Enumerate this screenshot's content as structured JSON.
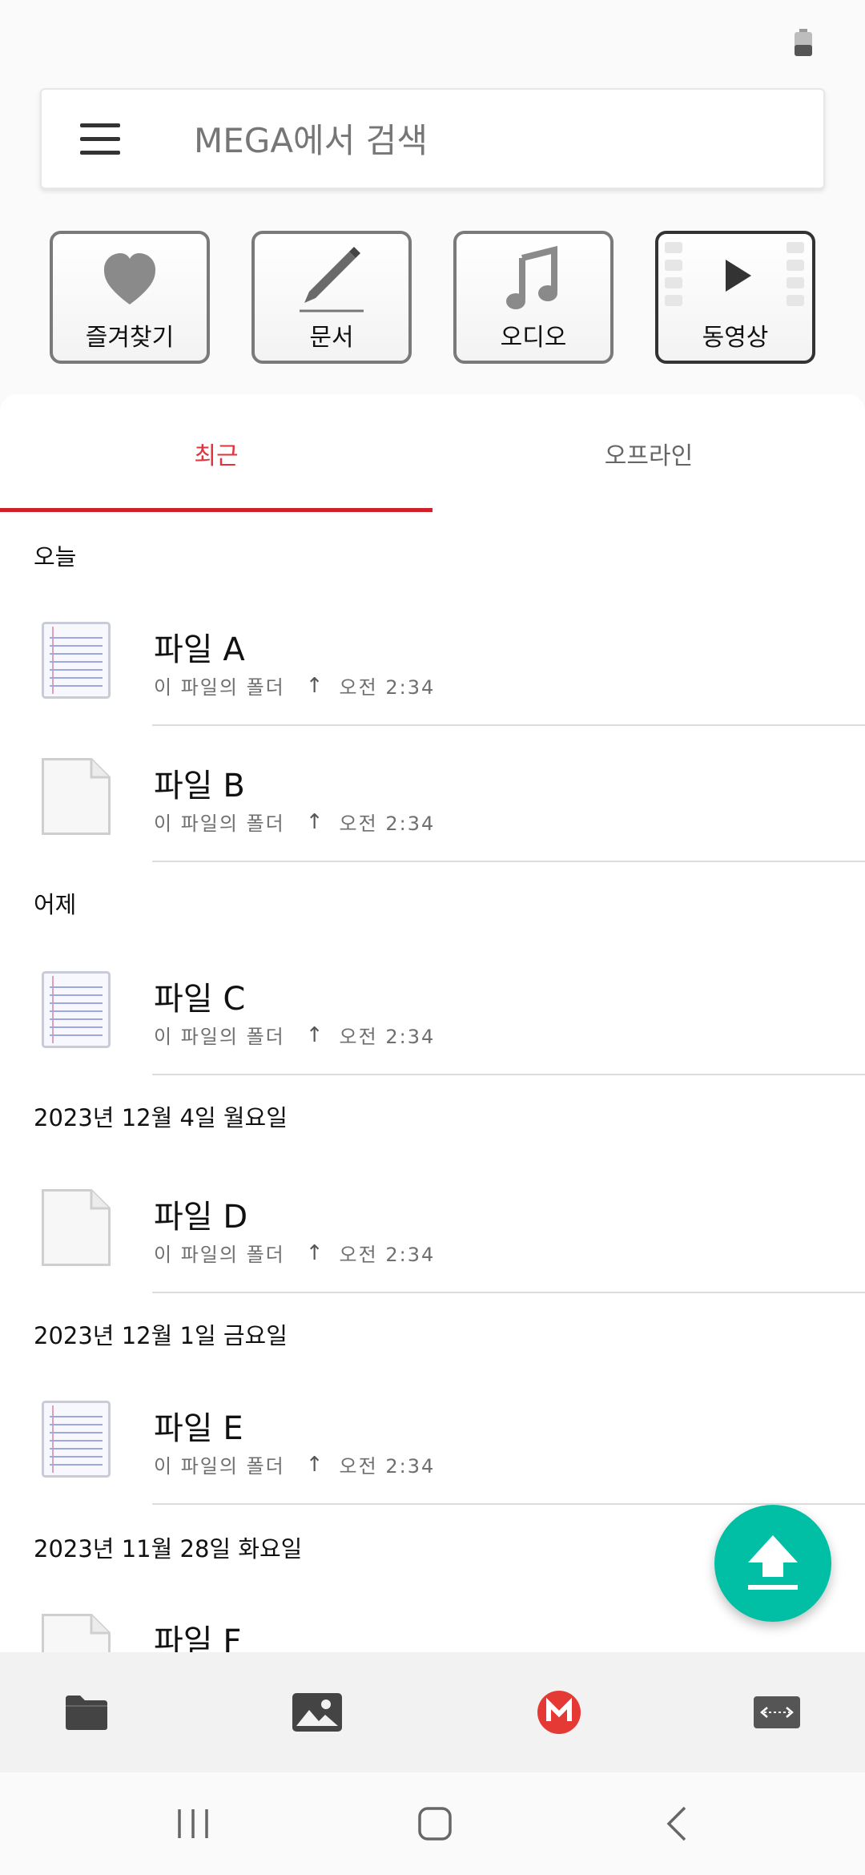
{
  "status_bar": {
    "battery_icon": "battery-low-icon"
  },
  "search": {
    "menu_icon": "hamburger-icon",
    "placeholder": "MEGA에서 검색"
  },
  "categories": [
    {
      "label": "즐겨찾기",
      "icon": "heart-icon"
    },
    {
      "label": "문서",
      "icon": "pencil-icon"
    },
    {
      "label": "오디오",
      "icon": "music-note-icon"
    },
    {
      "label": "동영상",
      "icon": "video-play-icon"
    }
  ],
  "tabs": [
    {
      "label": "최근",
      "active": true
    },
    {
      "label": "오프라인",
      "active": false
    }
  ],
  "groups": [
    {
      "date": "오늘",
      "files": [
        {
          "name": "파일 A",
          "type": "text",
          "folder": "이 파일의 폴더",
          "time": "오전 2:34"
        },
        {
          "name": "파일 B",
          "type": "blank",
          "folder": "이 파일의 폴더",
          "time": "오전 2:34"
        }
      ]
    },
    {
      "date": "어제",
      "files": [
        {
          "name": "파일 C",
          "type": "text",
          "folder": "이 파일의 폴더",
          "time": "오전 2:34"
        }
      ]
    },
    {
      "date": "2023년 12월 4일 월요일",
      "files": [
        {
          "name": "파일 D",
          "type": "blank",
          "folder": "이 파일의 폴더",
          "time": "오전 2:34"
        }
      ]
    },
    {
      "date": "2023년 12월 1일 금요일",
      "files": [
        {
          "name": "파일 E",
          "type": "text",
          "folder": "이 파일의 폴더",
          "time": "오전 2:34"
        }
      ]
    },
    {
      "date": "2023년 11월 28일 화요일",
      "files": [
        {
          "name": "파일 F",
          "type": "blank",
          "folder": "",
          "time": ""
        }
      ]
    }
  ],
  "upload_meta_arrow": "↑",
  "fab": {
    "icon": "upload-icon"
  },
  "bottom_nav": [
    {
      "icon": "folder-icon"
    },
    {
      "icon": "photos-icon"
    },
    {
      "icon": "mega-logo-icon"
    },
    {
      "icon": "transfers-icon"
    }
  ],
  "system_nav": [
    {
      "icon": "recent-apps-icon"
    },
    {
      "icon": "home-icon"
    },
    {
      "icon": "back-icon"
    }
  ],
  "colors": {
    "accent": "#d0212a",
    "fab": "#00bfa5",
    "mega_red": "#e53935"
  }
}
